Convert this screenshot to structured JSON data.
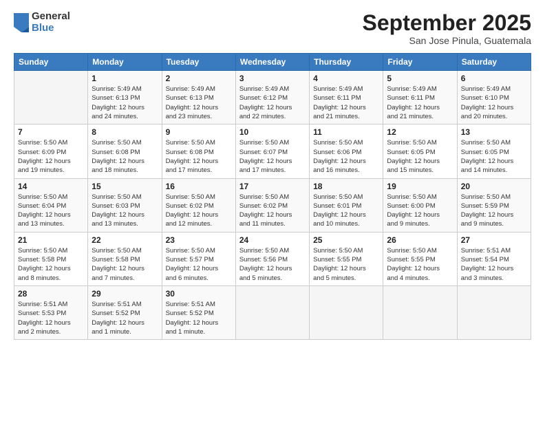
{
  "logo": {
    "general": "General",
    "blue": "Blue"
  },
  "title": "September 2025",
  "location": "San Jose Pinula, Guatemala",
  "days_header": [
    "Sunday",
    "Monday",
    "Tuesday",
    "Wednesday",
    "Thursday",
    "Friday",
    "Saturday"
  ],
  "weeks": [
    [
      {
        "day": "",
        "info": ""
      },
      {
        "day": "1",
        "info": "Sunrise: 5:49 AM\nSunset: 6:13 PM\nDaylight: 12 hours\nand 24 minutes."
      },
      {
        "day": "2",
        "info": "Sunrise: 5:49 AM\nSunset: 6:13 PM\nDaylight: 12 hours\nand 23 minutes."
      },
      {
        "day": "3",
        "info": "Sunrise: 5:49 AM\nSunset: 6:12 PM\nDaylight: 12 hours\nand 22 minutes."
      },
      {
        "day": "4",
        "info": "Sunrise: 5:49 AM\nSunset: 6:11 PM\nDaylight: 12 hours\nand 21 minutes."
      },
      {
        "day": "5",
        "info": "Sunrise: 5:49 AM\nSunset: 6:11 PM\nDaylight: 12 hours\nand 21 minutes."
      },
      {
        "day": "6",
        "info": "Sunrise: 5:49 AM\nSunset: 6:10 PM\nDaylight: 12 hours\nand 20 minutes."
      }
    ],
    [
      {
        "day": "7",
        "info": "Sunrise: 5:50 AM\nSunset: 6:09 PM\nDaylight: 12 hours\nand 19 minutes."
      },
      {
        "day": "8",
        "info": "Sunrise: 5:50 AM\nSunset: 6:08 PM\nDaylight: 12 hours\nand 18 minutes."
      },
      {
        "day": "9",
        "info": "Sunrise: 5:50 AM\nSunset: 6:08 PM\nDaylight: 12 hours\nand 17 minutes."
      },
      {
        "day": "10",
        "info": "Sunrise: 5:50 AM\nSunset: 6:07 PM\nDaylight: 12 hours\nand 17 minutes."
      },
      {
        "day": "11",
        "info": "Sunrise: 5:50 AM\nSunset: 6:06 PM\nDaylight: 12 hours\nand 16 minutes."
      },
      {
        "day": "12",
        "info": "Sunrise: 5:50 AM\nSunset: 6:05 PM\nDaylight: 12 hours\nand 15 minutes."
      },
      {
        "day": "13",
        "info": "Sunrise: 5:50 AM\nSunset: 6:05 PM\nDaylight: 12 hours\nand 14 minutes."
      }
    ],
    [
      {
        "day": "14",
        "info": "Sunrise: 5:50 AM\nSunset: 6:04 PM\nDaylight: 12 hours\nand 13 minutes."
      },
      {
        "day": "15",
        "info": "Sunrise: 5:50 AM\nSunset: 6:03 PM\nDaylight: 12 hours\nand 13 minutes."
      },
      {
        "day": "16",
        "info": "Sunrise: 5:50 AM\nSunset: 6:02 PM\nDaylight: 12 hours\nand 12 minutes."
      },
      {
        "day": "17",
        "info": "Sunrise: 5:50 AM\nSunset: 6:02 PM\nDaylight: 12 hours\nand 11 minutes."
      },
      {
        "day": "18",
        "info": "Sunrise: 5:50 AM\nSunset: 6:01 PM\nDaylight: 12 hours\nand 10 minutes."
      },
      {
        "day": "19",
        "info": "Sunrise: 5:50 AM\nSunset: 6:00 PM\nDaylight: 12 hours\nand 9 minutes."
      },
      {
        "day": "20",
        "info": "Sunrise: 5:50 AM\nSunset: 5:59 PM\nDaylight: 12 hours\nand 9 minutes."
      }
    ],
    [
      {
        "day": "21",
        "info": "Sunrise: 5:50 AM\nSunset: 5:58 PM\nDaylight: 12 hours\nand 8 minutes."
      },
      {
        "day": "22",
        "info": "Sunrise: 5:50 AM\nSunset: 5:58 PM\nDaylight: 12 hours\nand 7 minutes."
      },
      {
        "day": "23",
        "info": "Sunrise: 5:50 AM\nSunset: 5:57 PM\nDaylight: 12 hours\nand 6 minutes."
      },
      {
        "day": "24",
        "info": "Sunrise: 5:50 AM\nSunset: 5:56 PM\nDaylight: 12 hours\nand 5 minutes."
      },
      {
        "day": "25",
        "info": "Sunrise: 5:50 AM\nSunset: 5:55 PM\nDaylight: 12 hours\nand 5 minutes."
      },
      {
        "day": "26",
        "info": "Sunrise: 5:50 AM\nSunset: 5:55 PM\nDaylight: 12 hours\nand 4 minutes."
      },
      {
        "day": "27",
        "info": "Sunrise: 5:51 AM\nSunset: 5:54 PM\nDaylight: 12 hours\nand 3 minutes."
      }
    ],
    [
      {
        "day": "28",
        "info": "Sunrise: 5:51 AM\nSunset: 5:53 PM\nDaylight: 12 hours\nand 2 minutes."
      },
      {
        "day": "29",
        "info": "Sunrise: 5:51 AM\nSunset: 5:52 PM\nDaylight: 12 hours\nand 1 minute."
      },
      {
        "day": "30",
        "info": "Sunrise: 5:51 AM\nSunset: 5:52 PM\nDaylight: 12 hours\nand 1 minute."
      },
      {
        "day": "",
        "info": ""
      },
      {
        "day": "",
        "info": ""
      },
      {
        "day": "",
        "info": ""
      },
      {
        "day": "",
        "info": ""
      }
    ]
  ]
}
